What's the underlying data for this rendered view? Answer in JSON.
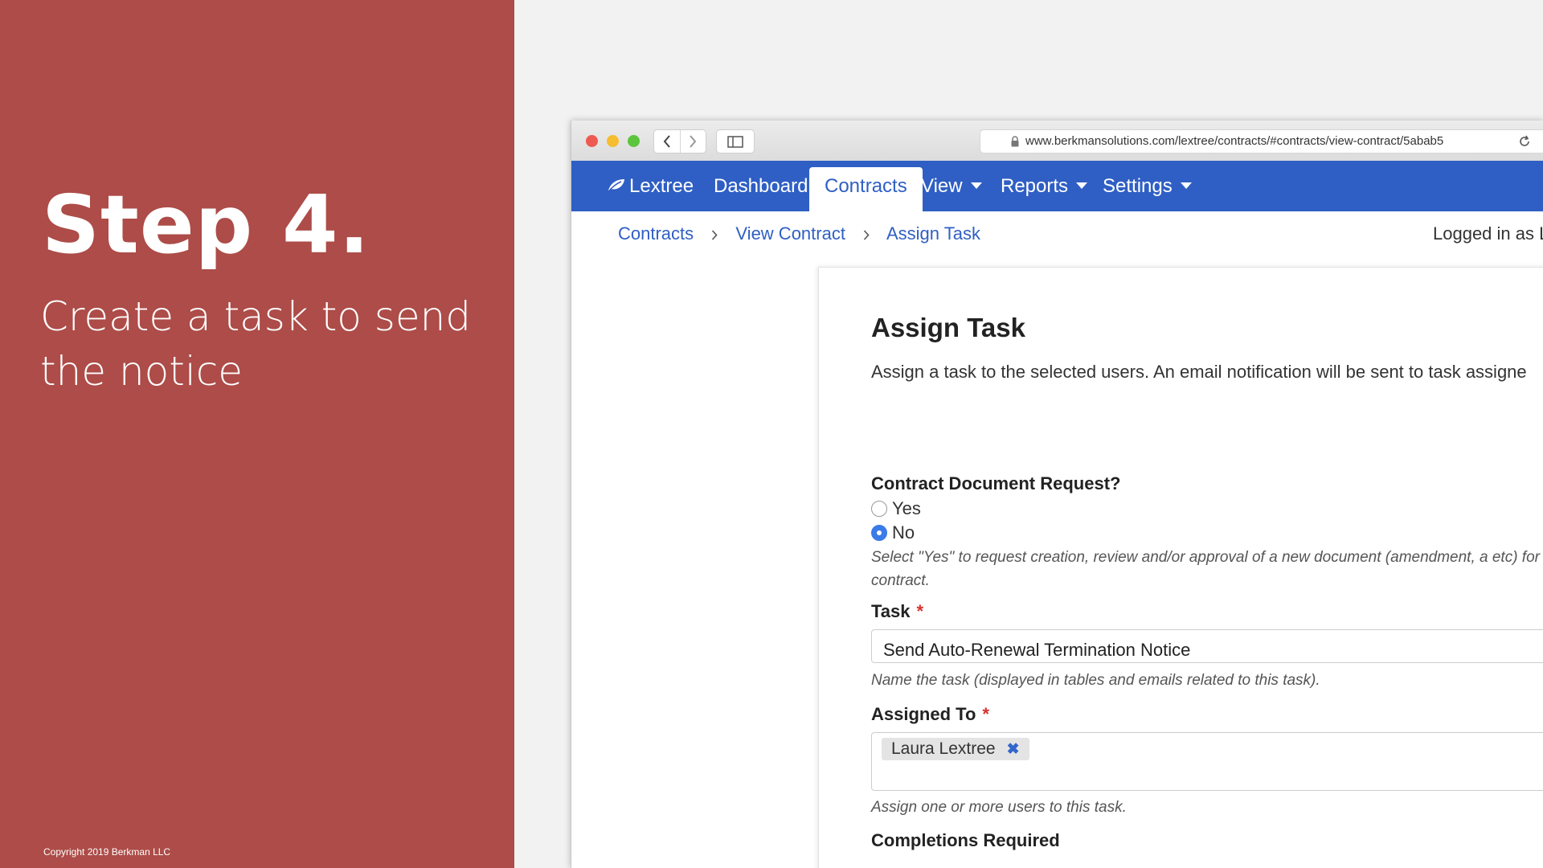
{
  "slide": {
    "step_title": "Step 4.",
    "step_subtitle": "Create a task to send the notice",
    "copyright": "Copyright 2019 Berkman LLC"
  },
  "browser": {
    "url": "www.berkmansolutions.com/lextree/contracts/#contracts/view-contract/5abab5"
  },
  "topnav": {
    "brand": "Lextree",
    "items": [
      {
        "label": "Dashboard"
      },
      {
        "label": "Contracts",
        "active": true
      },
      {
        "label": "View"
      },
      {
        "label": "Reports"
      },
      {
        "label": "Settings"
      }
    ]
  },
  "breadcrumb": [
    "Contracts",
    "View Contract",
    "Assign Task"
  ],
  "logged_in": "Logged in as L",
  "form": {
    "title": "Assign Task",
    "description": "Assign a task to the selected users. An email notification will be sent to task assigne",
    "contract_request": {
      "label": "Contract Document Request?",
      "options": [
        "Yes",
        "No"
      ],
      "selected": "No",
      "help": "Select \"Yes\" to request creation, review and/or approval of a new document (amendment, a etc) for this contract."
    },
    "task": {
      "label": "Task",
      "required_mark": "*",
      "value": "Send Auto-Renewal Termination Notice",
      "help": "Name the task (displayed in tables and emails related to this task)."
    },
    "assigned_to": {
      "label": "Assigned To",
      "required_mark": "*",
      "tags": [
        "Laura Lextree"
      ],
      "remove_symbol": "✖",
      "help": "Assign one or more users to this task."
    },
    "completions_required": {
      "label": "Completions Required"
    }
  },
  "colors": {
    "panel": "#ad4c48",
    "nav": "#2f5fc4",
    "link": "#2f5fc4",
    "required": "#d9302c"
  }
}
